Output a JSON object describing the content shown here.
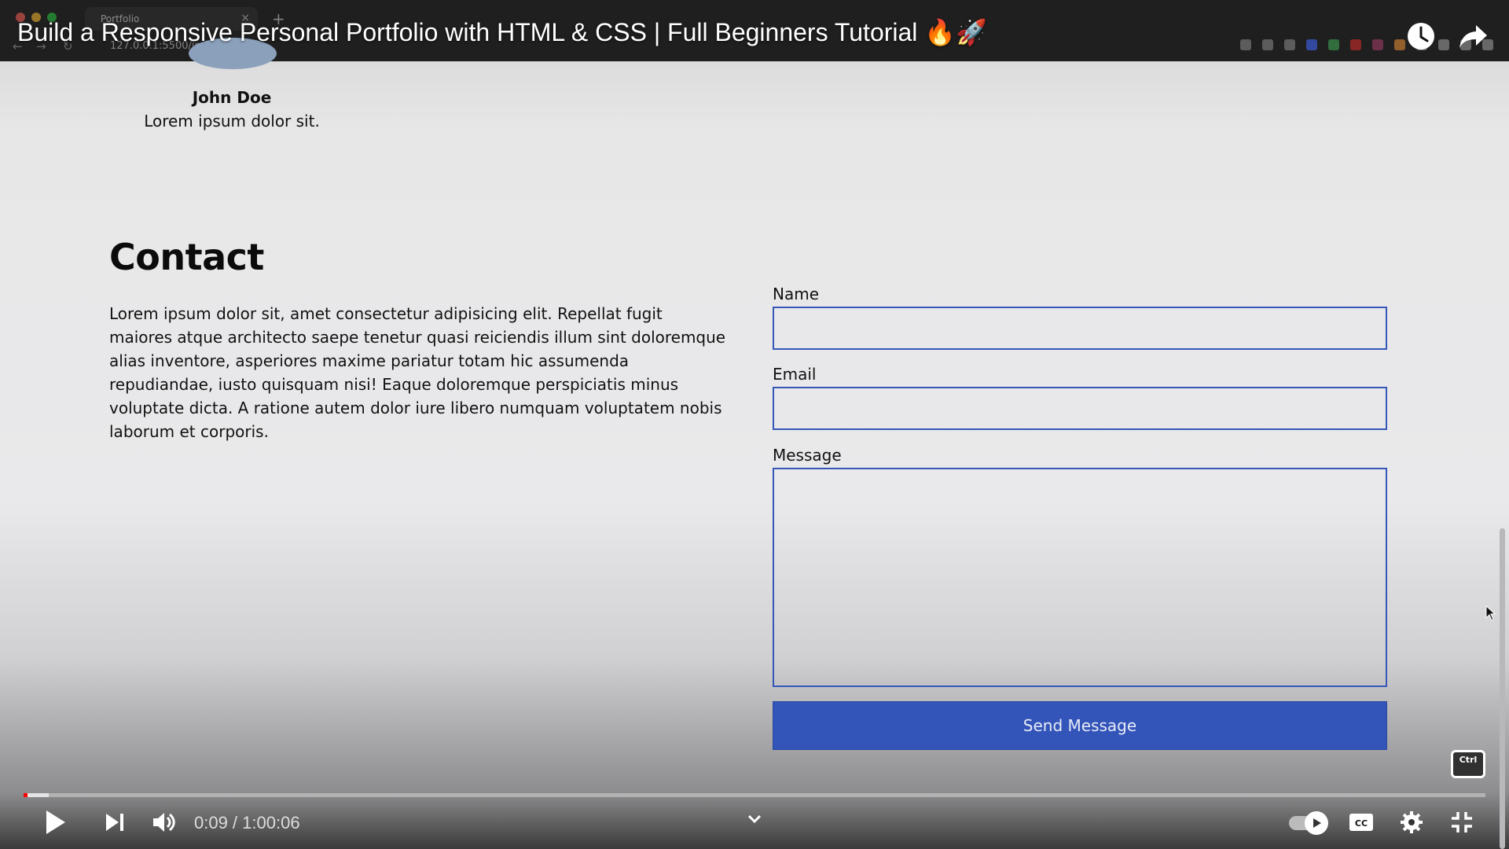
{
  "browser": {
    "tab_title": "Portfolio",
    "url": "127.0.0.1:5500/index.html"
  },
  "video": {
    "title": "Build a Responsive Personal Portfolio with HTML & CSS | Full Beginners Tutorial 🔥🚀",
    "time": "0:09 / 1:00:06",
    "progress_fraction": 0.0025
  },
  "profile": {
    "name": "John Doe",
    "role": "Lorem ipsum dolor sit."
  },
  "contact": {
    "heading": "Contact",
    "body": "Lorem ipsum dolor sit, amet consectetur adipisicing elit. Repellat fugit maiores atque architecto saepe tenetur quasi reiciendis illum sint doloremque alias inventore, asperiores maxime pariatur totam hic assumenda repudiandae, iusto quisquam nisi! Eaque doloremque perspiciatis minus voluptate dicta. A ratione autem dolor iure libero numquam voluptatem nobis laborum et corporis."
  },
  "form": {
    "name_label": "Name",
    "name_value": "",
    "email_label": "Email",
    "email_value": "",
    "message_label": "Message",
    "message_value": "",
    "submit_label": "Send Message"
  },
  "overlay": {
    "ctrl_badge": "Ctrl"
  },
  "colors": {
    "accent": "#3355b9",
    "progress": "#ff0000"
  }
}
